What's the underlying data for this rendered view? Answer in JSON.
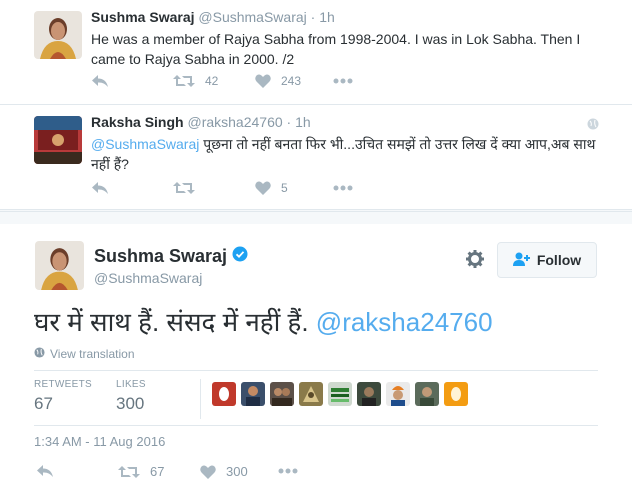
{
  "tweet1": {
    "name": "Sushma Swaraj",
    "handle": "@SushmaSwaraj",
    "separator": "·",
    "time": "1h",
    "text": "He was a member of Rajya Sabha from 1998-2004. I was in Lok Sabha. Then I came to Rajya Sabha in 2000. /2",
    "retweets": "42",
    "likes": "243"
  },
  "tweet2": {
    "name": "Raksha Singh",
    "handle": "@raksha24760",
    "separator": "·",
    "time": "1h",
    "mention": "@SushmaSwaraj",
    "text": " पूछना तो नहीं बनता फिर भी...उचित समझें तो उत्तर लिख दें क्या आप,अब साथ नहीं हैं?",
    "retweets": "",
    "likes": "5"
  },
  "main": {
    "name": "Sushma Swaraj",
    "handle": "@SushmaSwaraj",
    "follow_label": "Follow",
    "text": "घर में साथ हैं. संसद में नहीं हैं. ",
    "mention": "@raksha24760",
    "view_translation": "View translation",
    "retweets_label": "RETWEETS",
    "retweets": "67",
    "likes_label": "LIKES",
    "likes": "300",
    "date": "1:34 AM - 11 Aug 2016",
    "action_retweets": "67",
    "action_likes": "300"
  },
  "colors": {
    "accent": "#55acee",
    "muted": "#8899a6",
    "verified": "#1da1f2",
    "text": "#292f33"
  },
  "icons": [
    "reply-icon",
    "retweet-icon",
    "heart-icon",
    "more-icon",
    "globe-icon",
    "gear-icon",
    "follow-person-icon",
    "verified-icon"
  ]
}
